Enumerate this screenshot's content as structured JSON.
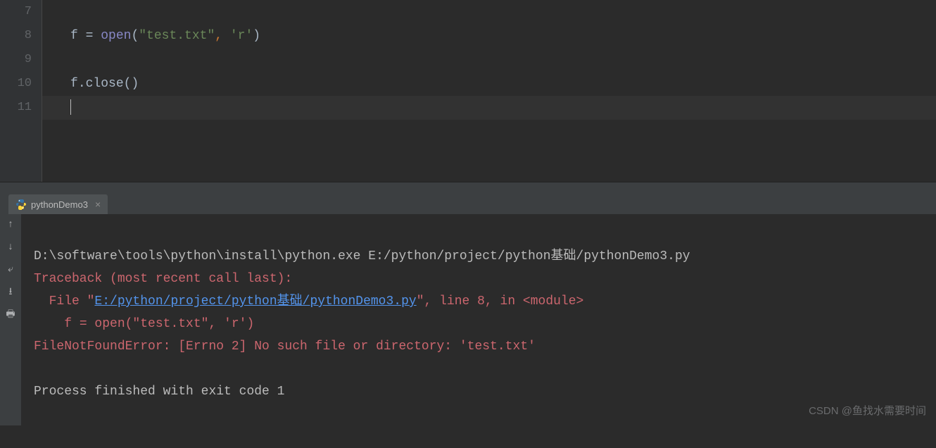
{
  "gutter": {
    "start": 7,
    "end": 11
  },
  "code": {
    "line8": {
      "ident": "f",
      "eq": " = ",
      "builtin": "open",
      "lp": "(",
      "str1": "\"test.txt\"",
      "comma": ", ",
      "str2": "'r'",
      "rp": ")"
    },
    "line10": {
      "ident": "f",
      "dot": ".",
      "method": "close",
      "paren": "()"
    }
  },
  "tab": {
    "name": "pythonDemo3",
    "close": "×"
  },
  "console": {
    "cmd": "D:\\software\\tools\\python\\install\\python.exe E:/python/project/python基础/pythonDemo3.py",
    "tb1": "Traceback (most recent call last):",
    "tb2a": "  File \"",
    "tb2link": "E:/python/project/python基础/pythonDemo3.py",
    "tb2b": "\", line 8, in <module>",
    "tb3": "    f = open(\"test.txt\", 'r')",
    "tb4": "FileNotFoundError: [Errno 2] No such file or directory: 'test.txt'",
    "blank": "",
    "exit": "Process finished with exit code 1"
  },
  "watermark": "CSDN @鱼找水需要时间"
}
